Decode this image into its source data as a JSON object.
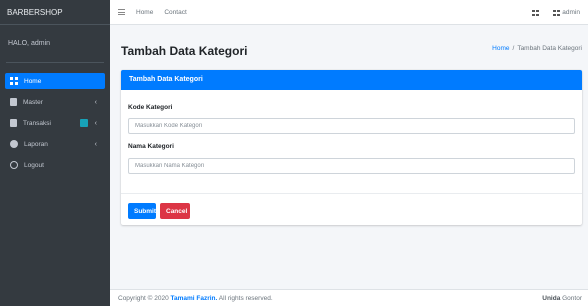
{
  "brand": {
    "title": "BARBERSHOP"
  },
  "user": {
    "greeting": "HALO, admin"
  },
  "sidebar": {
    "items": [
      {
        "label": "Home",
        "icon": "grid-icon",
        "active": true
      },
      {
        "label": "Master",
        "icon": "copy-icon",
        "chevron": "‹"
      },
      {
        "label": "Transaksi",
        "icon": "copy-icon",
        "badge": "",
        "chevron": "‹"
      },
      {
        "label": "Laporan",
        "icon": "globe-icon",
        "chevron": "‹"
      },
      {
        "label": "Logout",
        "icon": "circle-icon"
      }
    ]
  },
  "topbar": {
    "links": [
      "Home",
      "Contact"
    ],
    "user_label": "admin"
  },
  "page": {
    "title": "Tambah Data Kategori",
    "breadcrumb": {
      "home": "Home",
      "separator": "/",
      "current": "Tambah Data Kategori"
    }
  },
  "card": {
    "header": "Tambah Data Kategori",
    "fields": [
      {
        "label": "Kode Kategori",
        "placeholder": "Masukkan Kode Kategori",
        "value": ""
      },
      {
        "label": "Nama Kategori",
        "placeholder": "Masukkan Nama Kategori",
        "value": ""
      }
    ],
    "submit_label": "Submit",
    "cancel_label": "Cancel"
  },
  "footer": {
    "prefix": "Copyright © 2020",
    "author": "Tamami Fazrin.",
    "suffix": "All rights reserved.",
    "right_bold": "Unida",
    "right_normal": "Gontor"
  },
  "colors": {
    "primary": "#007bff",
    "danger": "#dc3545",
    "sidebar": "#343a40"
  }
}
